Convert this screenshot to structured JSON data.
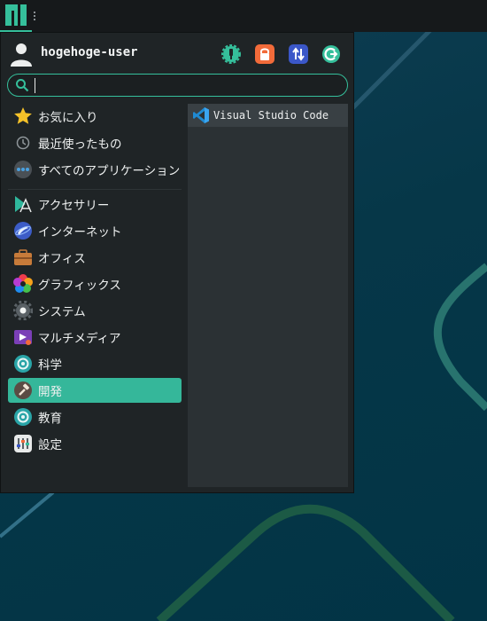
{
  "user": {
    "name": "hogehoge-user"
  },
  "actions": [
    {
      "name": "settings-manager-icon",
      "color": "#35bf9b"
    },
    {
      "name": "lock-screen-icon",
      "color": "#f26b3a"
    },
    {
      "name": "switch-user-icon",
      "color": "#3b57c8"
    },
    {
      "name": "logout-icon",
      "color": "#35bf9b"
    }
  ],
  "search": {
    "value": "",
    "placeholder": ""
  },
  "categories": [
    {
      "label": "お気に入り",
      "icon": "star-icon"
    },
    {
      "label": "最近使ったもの",
      "icon": "clock-icon"
    },
    {
      "label": "すべてのアプリケーション",
      "icon": "all-apps-icon"
    },
    {
      "label": "アクセサリー",
      "icon": "accessories-icon"
    },
    {
      "label": "インターネット",
      "icon": "internet-icon"
    },
    {
      "label": "オフィス",
      "icon": "office-briefcase-icon"
    },
    {
      "label": "グラフィックス",
      "icon": "graphics-icon"
    },
    {
      "label": "システム",
      "icon": "system-gear-icon"
    },
    {
      "label": "マルチメディア",
      "icon": "multimedia-icon"
    },
    {
      "label": "科学",
      "icon": "science-icon"
    },
    {
      "label": "開発",
      "icon": "development-hammer-icon",
      "selected": true
    },
    {
      "label": "教育",
      "icon": "education-icon"
    },
    {
      "label": "設定",
      "icon": "settings-icon"
    }
  ],
  "apps": [
    {
      "label": "Visual Studio Code",
      "icon": "vscode-icon"
    }
  ],
  "colors": {
    "accent": "#35b79a",
    "menu_bg": "#1f2426",
    "apps_bg": "#2b3134"
  }
}
